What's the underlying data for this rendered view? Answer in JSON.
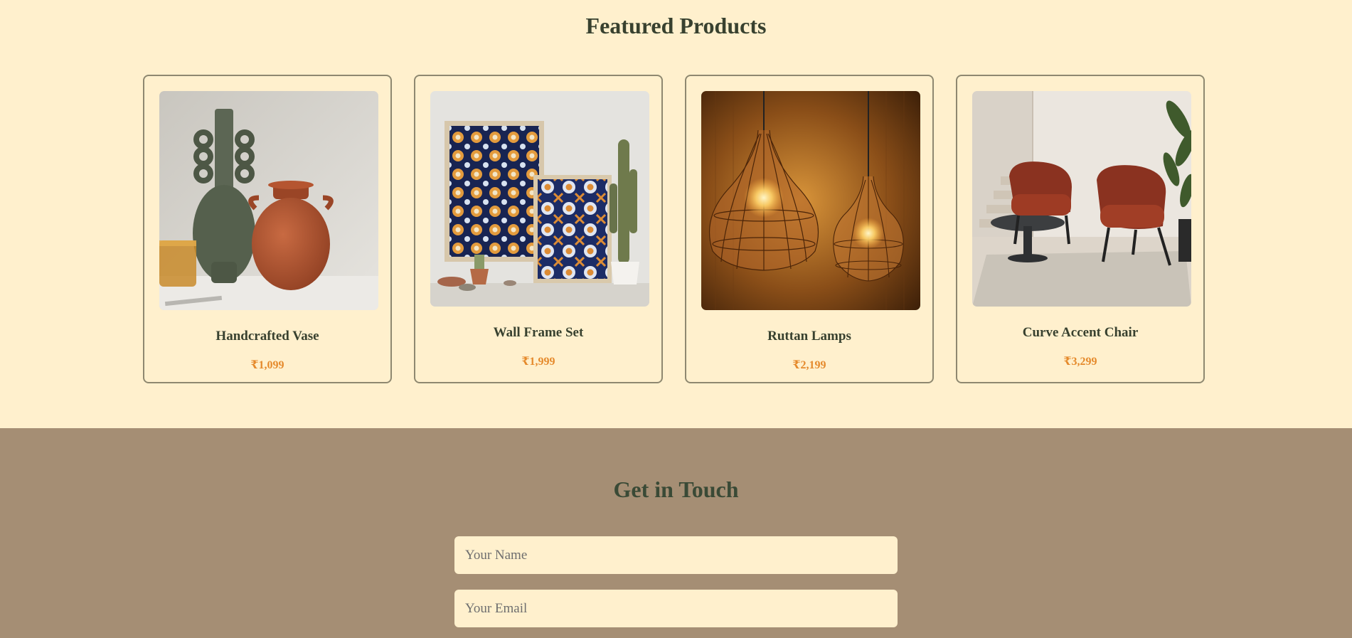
{
  "featured": {
    "title": "Featured Products",
    "products": [
      {
        "name": "Handcrafted Vase",
        "price": "₹1,099",
        "image_icon": "vase-image"
      },
      {
        "name": "Wall Frame Set",
        "price": "₹1,999",
        "image_icon": "wall-frame-image"
      },
      {
        "name": "Ruttan Lamps",
        "price": "₹2,199",
        "image_icon": "rattan-lamp-image"
      },
      {
        "name": "Curve Accent Chair",
        "price": "₹3,299",
        "image_icon": "accent-chair-image"
      }
    ]
  },
  "contact": {
    "title": "Get in Touch",
    "name_placeholder": "Your Name",
    "email_placeholder": "Your Email"
  },
  "colors": {
    "page_bg": "#FFF0CD",
    "heading": "#38412F",
    "price": "#E58A2C",
    "card_border": "#8E8870",
    "contact_bg": "#A58E74"
  }
}
